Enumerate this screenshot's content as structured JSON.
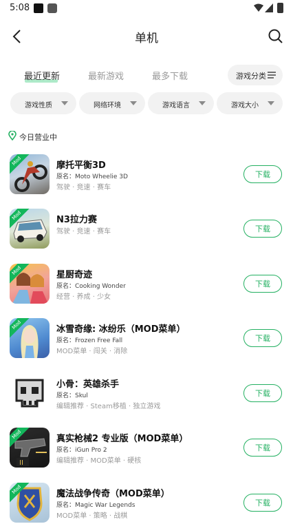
{
  "status_bar": {
    "time": "5:08"
  },
  "header": {
    "title": "单机"
  },
  "tabs": [
    {
      "label": "最近更新",
      "active": true
    },
    {
      "label": "最新游戏",
      "active": false
    },
    {
      "label": "最多下载",
      "active": false
    }
  ],
  "category_button": {
    "label": "游戏分类"
  },
  "filters": [
    {
      "label": "游戏性质"
    },
    {
      "label": "网络环境"
    },
    {
      "label": "游戏语言"
    },
    {
      "label": "游戏大小"
    }
  ],
  "section": {
    "label": "今日营业中"
  },
  "download_label": "下载",
  "mod_badge": "Mod",
  "games": [
    {
      "name": "摩托平衡3D",
      "original": "原名：Moto Wheelie 3D",
      "tags": "驾驶 · 竞速 · 赛车",
      "mod": true
    },
    {
      "name": "N3拉力赛",
      "original": "",
      "tags": "驾驶 · 竞速 · 赛车",
      "mod": true
    },
    {
      "name": "星厨奇迹",
      "original": "原名：Cooking Wonder",
      "tags": "经营 · 养成 · 少女",
      "mod": true
    },
    {
      "name": "冰雪奇缘: 冰纷乐（MOD菜单）",
      "original": "原名：Frozen Free Fall",
      "tags": "MOD菜单 · 闯关 · 消除",
      "mod": true
    },
    {
      "name": "小骨：英雄杀手",
      "original": "原名：Skul",
      "tags": "编辑推荐 · Steam移植 · 独立游戏",
      "mod": false
    },
    {
      "name": "真实枪械2 专业版（MOD菜单）",
      "original": "原名：iGun Pro 2",
      "tags": "编辑推荐 · MOD菜单 · 硬核",
      "mod": true
    },
    {
      "name": "魔法战争传奇（MOD菜单）",
      "original": "原名：Magic War Legends",
      "tags": "MOD菜单 · 策略 · 战棋",
      "mod": true
    }
  ],
  "colors": {
    "accent": "#23b061",
    "badge": "#13b65b",
    "tab_underline": "#aeeac9"
  }
}
